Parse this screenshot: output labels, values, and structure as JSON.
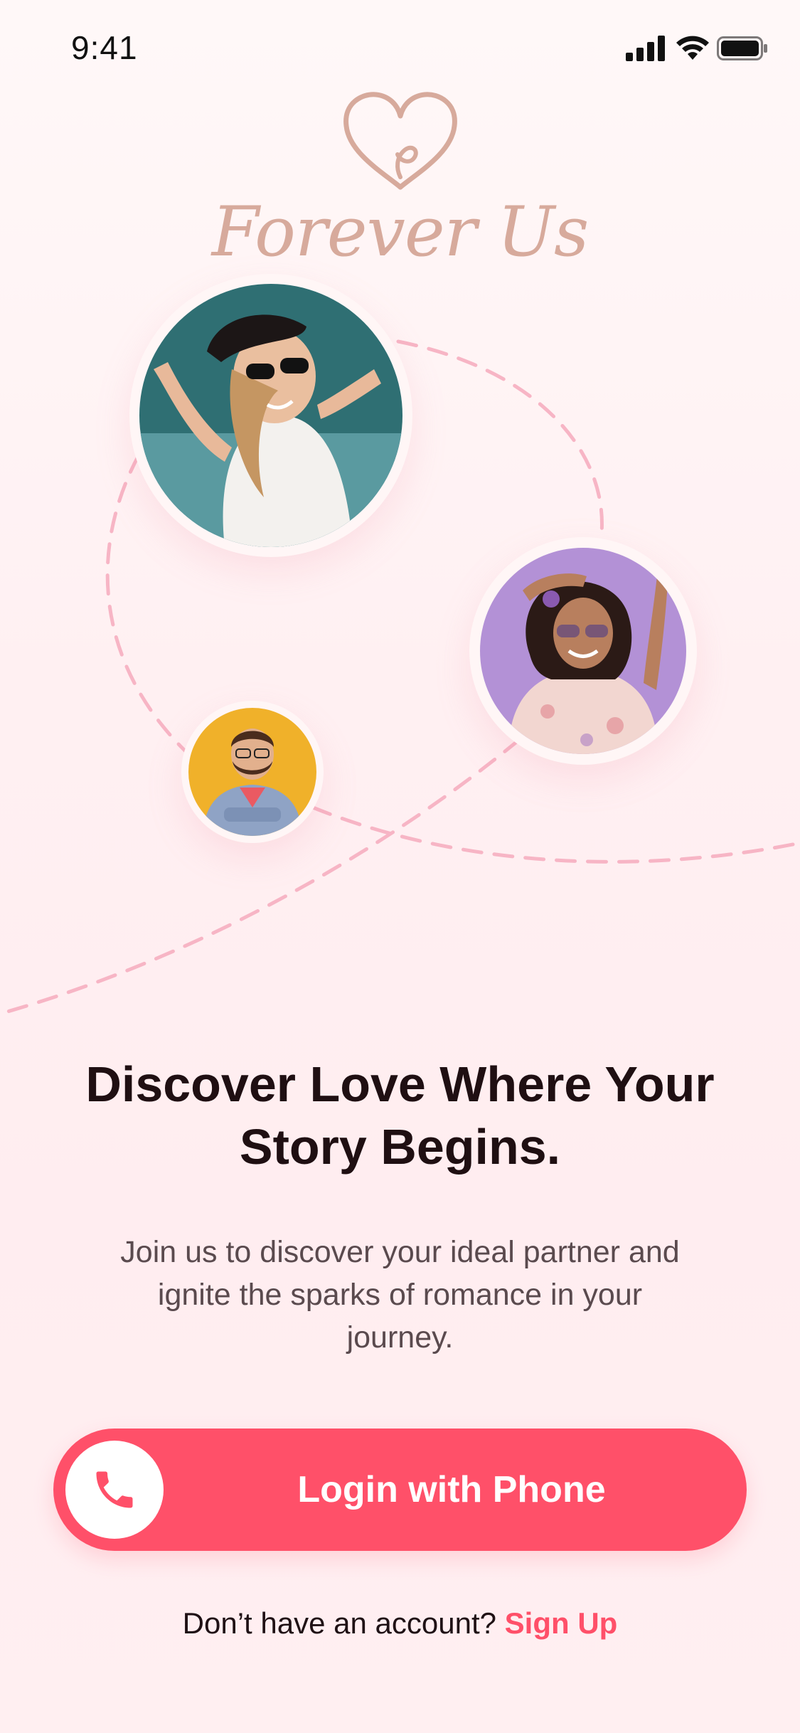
{
  "status_bar": {
    "time": "9:41",
    "icons": [
      "cellular-signal-icon",
      "wifi-icon",
      "battery-icon"
    ]
  },
  "logo": {
    "icon": "heart-logo-icon",
    "text": "Forever Us"
  },
  "profiles": [
    {
      "name": "profile-photo-woman-sunglasses"
    },
    {
      "name": "profile-photo-woman-curly-hair"
    },
    {
      "name": "profile-photo-man-glasses"
    }
  ],
  "headline": {
    "line1": "Discover Love Where Your",
    "line2": "Story Begins."
  },
  "subtitle": "Join us to discover your ideal partner and ignite the sparks of romance in your journey.",
  "login": {
    "label": "Login with Phone",
    "icon": "phone-icon"
  },
  "signup": {
    "prompt": "Don’t have an account?",
    "link": "Sign Up"
  },
  "colors": {
    "accent": "#ff5069",
    "logo": "#d7aa9c",
    "dash": "#f7b5c5"
  }
}
